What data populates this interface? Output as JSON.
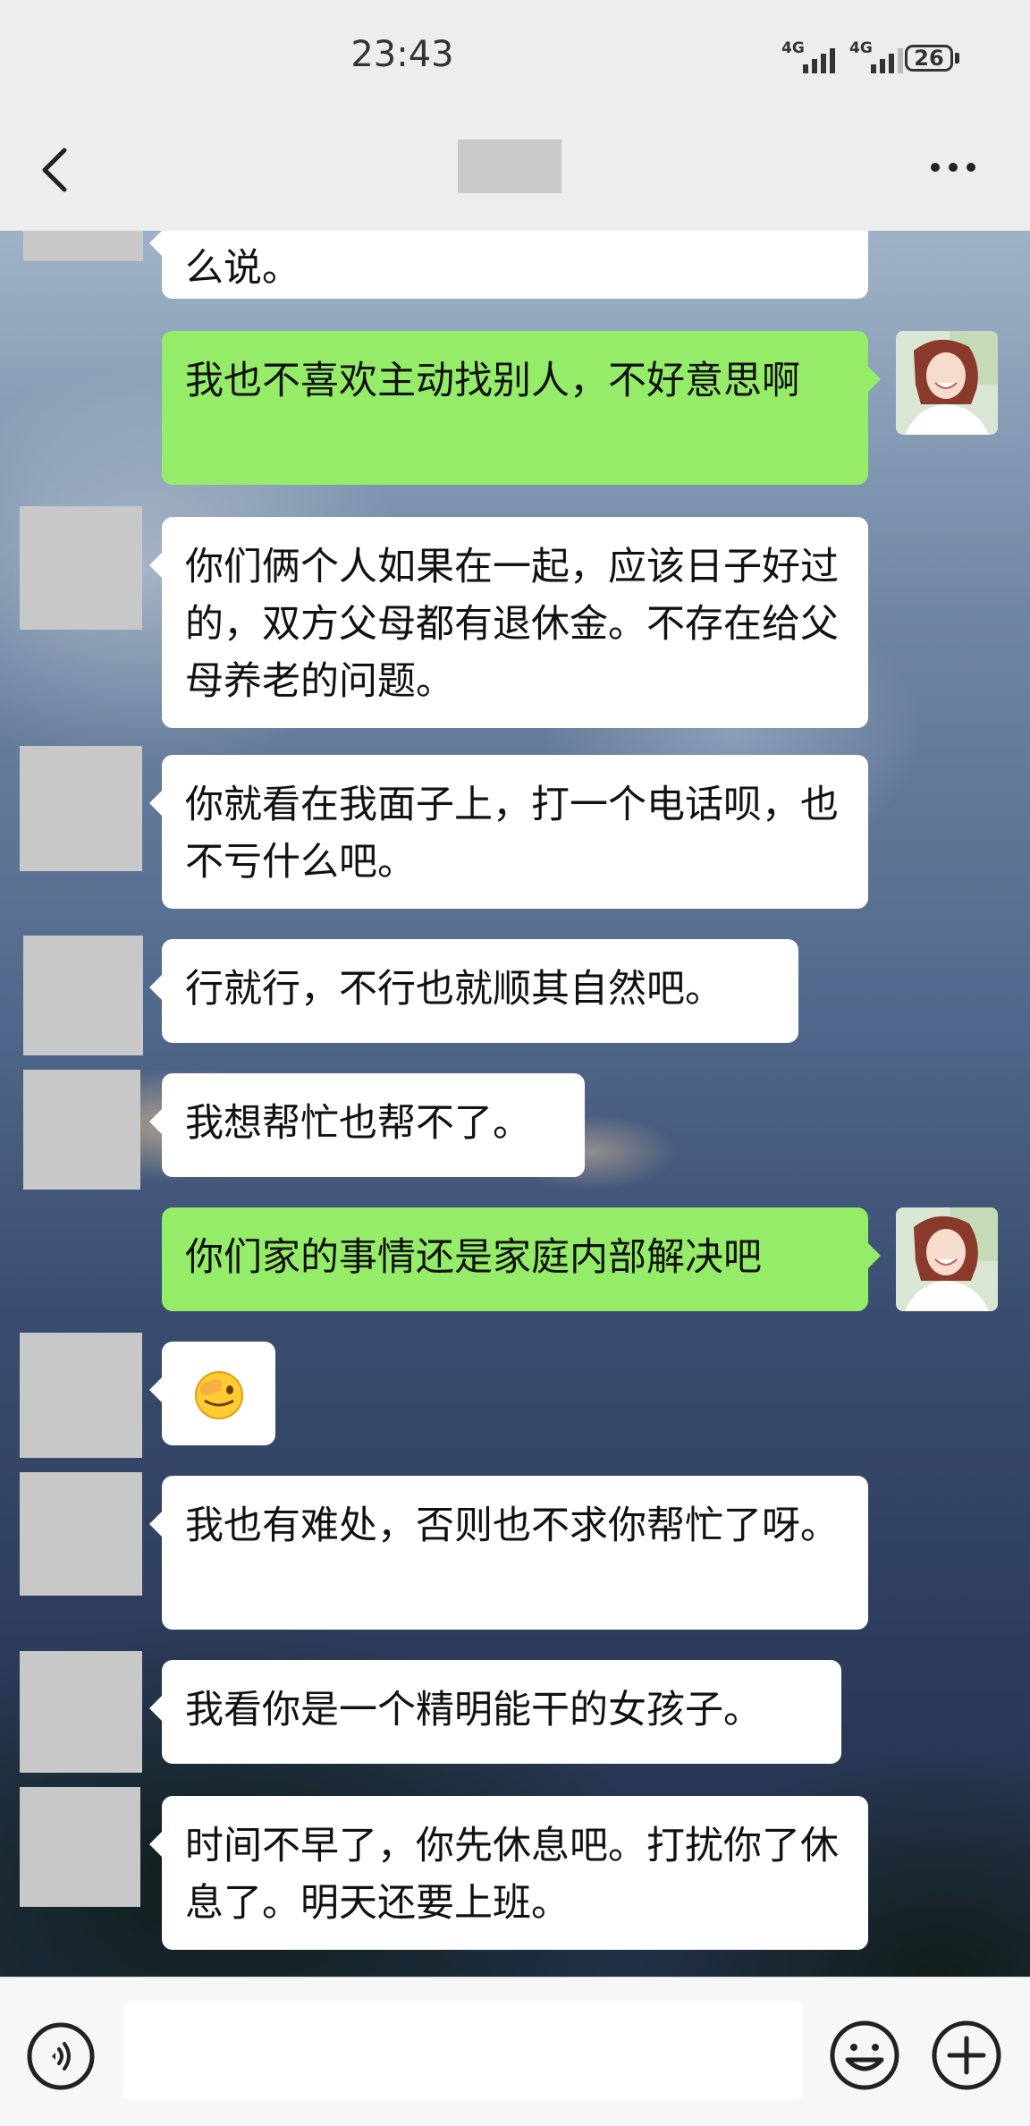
{
  "status_bar": {
    "time": "23:43",
    "signal1_label": "4G",
    "signal2_label": "4G",
    "battery": "26"
  },
  "header": {
    "back_icon": "chevron-left-icon",
    "more_icon": "more-dots-icon"
  },
  "messages": [
    {
      "side": "in",
      "text": "么说。"
    },
    {
      "side": "out",
      "text": "我也不喜欢主动找别人，不好意思啊"
    },
    {
      "side": "in",
      "text": "你们俩个人如果在一起，应该日子好过的，双方父母都有退休金。不存在给父母养老的问题。"
    },
    {
      "side": "in",
      "text": "你就看在我面子上，打一个电话呗，也不亏什么吧。"
    },
    {
      "side": "in",
      "text": "行就行，不行也就顺其自然吧。"
    },
    {
      "side": "in",
      "text": "我想帮忙也帮不了。"
    },
    {
      "side": "out",
      "text": "你们家的事情还是家庭内部解决吧"
    },
    {
      "side": "in",
      "emoji": "facepalm-emoji"
    },
    {
      "side": "in",
      "text": "我也有难处，否则也不求你帮忙了呀。"
    },
    {
      "side": "in",
      "text": "我看你是一个精明能干的女孩子。"
    },
    {
      "side": "in",
      "text": "时间不早了，你先休息吧。打扰你了休息了。明天还要上班。"
    }
  ],
  "input_bar": {
    "voice_icon": "voice-icon",
    "emoji_icon": "emoji-icon",
    "plus_icon": "plus-icon",
    "input_value": ""
  },
  "colors": {
    "bubble_out": "#95ec69",
    "bubble_in": "#ffffff",
    "bar_bg": "#ededed"
  }
}
